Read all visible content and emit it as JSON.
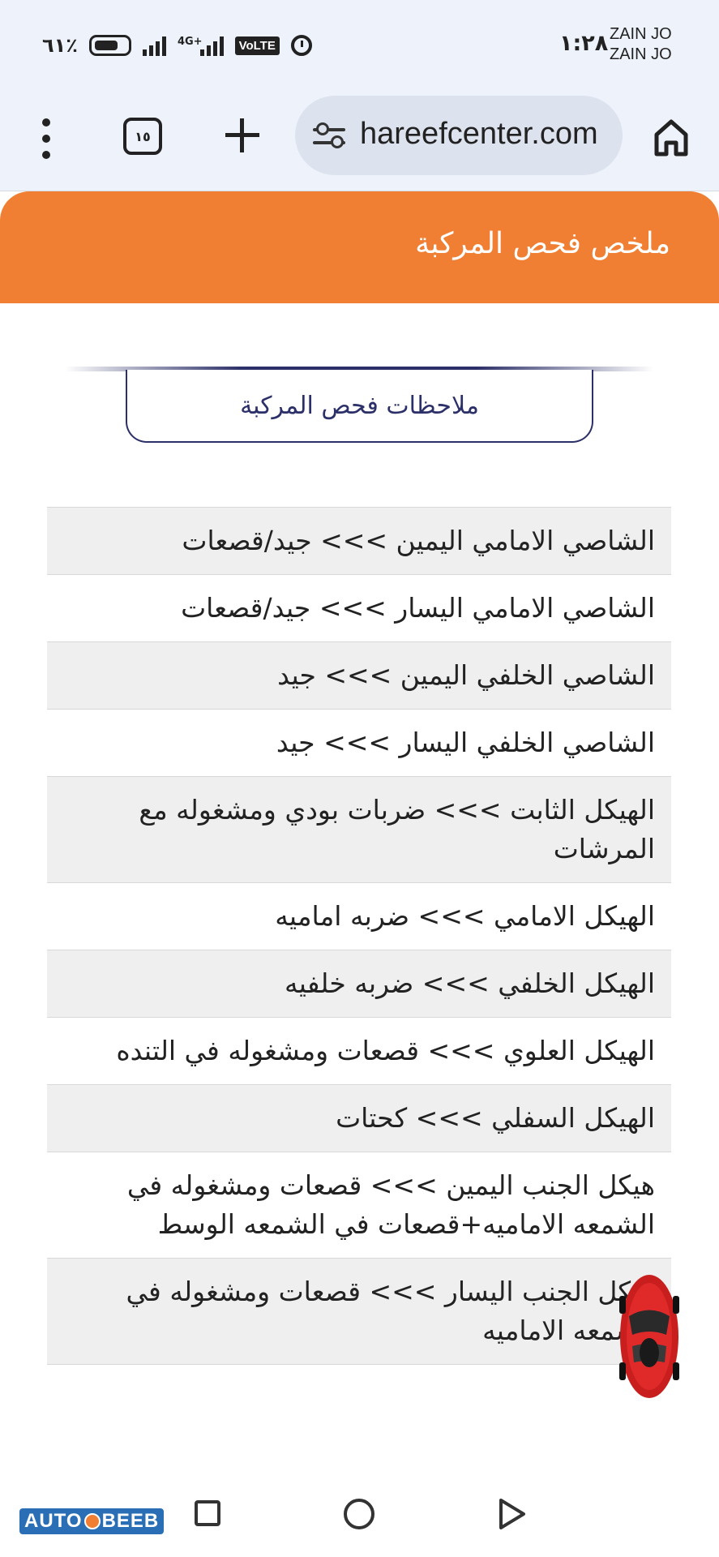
{
  "status_bar": {
    "carrier_1": "ZAIN JO",
    "carrier_2": "ZAIN JO",
    "time": "١:٢٨",
    "battery_percent": "٦١٪",
    "network": "4G+",
    "volte": "VoLTE",
    "icons": [
      "battery-icon",
      "signal-icon",
      "signal-4g-icon",
      "volte-icon",
      "alarm-icon"
    ]
  },
  "browser": {
    "url": "hareefcenter.com",
    "tab_count": "١٥",
    "icons": [
      "menu-dots-icon",
      "tabs-icon",
      "new-tab-plus-icon",
      "site-settings-icon",
      "home-icon"
    ]
  },
  "page": {
    "header_title": "ملخص فحص المركبة",
    "header_color": "#f07f33",
    "notes_tab_label": "ملاحظات فحص المركبة",
    "notes_tab_color": "#2c3068",
    "notes": [
      "الشاصي الامامي اليمين >>> جيد/قصعات",
      "الشاصي الامامي اليسار >>> جيد/قصعات",
      "الشاصي الخلفي اليمين >>> جيد",
      "الشاصي الخلفي اليسار >>> جيد",
      "الهيكل الثابت >>> ضربات بودي ومشغوله مع المرشات",
      "الهيكل الامامي >>> ضربه اماميه",
      "الهيكل الخلفي >>> ضربه خلفيه",
      "الهيكل العلوي >>> قصعات ومشغوله في التنده",
      "الهيكل السفلي >>> كحتات",
      "هيكل الجنب اليمين >>> قصعات ومشغوله في الشمعه الاماميه+قصعات في الشمعه الوسط",
      "هيكل الجنب اليسار >>> قصعات ومشغوله في الشمعه الاماميه"
    ]
  },
  "watermark": {
    "text_1": "AUTO",
    "text_2": "BEEB"
  },
  "nav_bar": {
    "icons": [
      "recents-square-icon",
      "home-circle-icon",
      "back-triangle-icon"
    ]
  }
}
